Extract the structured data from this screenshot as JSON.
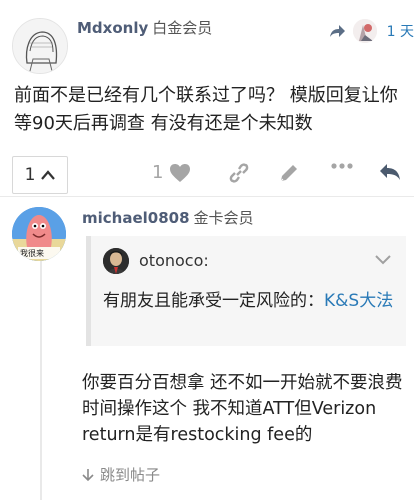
{
  "post1": {
    "username": "Mdxonly",
    "user_title": "白金会员",
    "reply_to_time": "1 天",
    "text": "前面不是已经有几个联系过了吗？ 模版回复让你等90天后再调查 有没有还是个未知数"
  },
  "actions": {
    "replies_count": "1",
    "like_count": "1"
  },
  "post2": {
    "username": "michael0808",
    "user_title": "金卡会员",
    "avatar_caption": "我很来",
    "quote": {
      "username": "otonoco:",
      "text_plain": "有朋友且能承受一定风险的：",
      "text_link": "K&S大法"
    },
    "text": "你要百分百想拿 还不如一开始就不要浪费时间操作这个 我不知道ATT但Verizon return是有restocking fee的",
    "jump_label": "跳到帖子"
  },
  "colors": {
    "link": "#2a7ab7",
    "username": "#4f5d77",
    "icon_gray": "#a5a5a5"
  }
}
